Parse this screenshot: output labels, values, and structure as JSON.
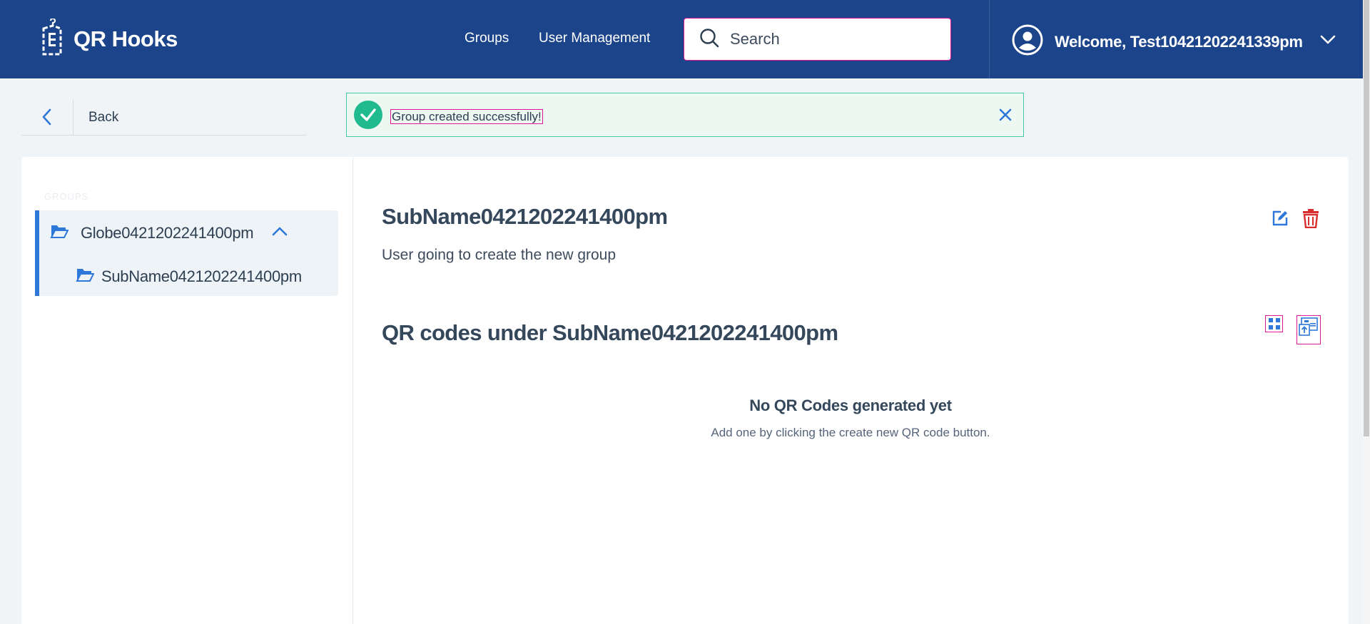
{
  "app": {
    "name": "QR Hooks"
  },
  "nav": {
    "groups": "Groups",
    "user_management": "User Management"
  },
  "search": {
    "placeholder": "Search"
  },
  "user": {
    "welcome": "Welcome, Test10421202241339pm"
  },
  "back": {
    "label": "Back"
  },
  "toast": {
    "message": "Group created successfully!",
    "status_color": "#1fba8d"
  },
  "sidebar": {
    "heading": "GROUPS",
    "tree": [
      {
        "label": "Globe0421202241400pm",
        "expanded": true,
        "children": [
          {
            "label": "SubName0421202241400pm",
            "selected": true
          }
        ]
      }
    ]
  },
  "group": {
    "title": "SubName0421202241400pm",
    "description": "User going to create the new group"
  },
  "qr_section": {
    "title": "QR codes under SubName0421202241400pm",
    "empty_title": "No QR Codes generated yet",
    "empty_subtitle": "Add one by clicking the create new QR code button."
  },
  "colors": {
    "header": "#1c448a",
    "accent": "#2d78d8",
    "danger": "#d92e2e",
    "highlight": "#e0179a"
  },
  "icons": [
    "logo-icon",
    "search-icon",
    "user-avatar-icon",
    "chevron-down-icon",
    "chevron-left-icon",
    "check-icon",
    "close-icon",
    "folder-open-icon",
    "chevron-up-icon",
    "edit-icon",
    "trash-icon",
    "grid-view-icon",
    "upload-qr-icon"
  ]
}
